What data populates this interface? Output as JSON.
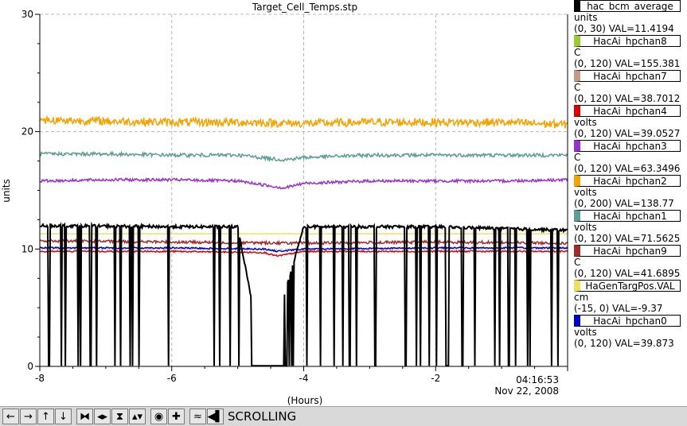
{
  "toolbar": {
    "buttons": [
      "←",
      "→",
      "↑",
      "↓",
      "⧓",
      "◂▸",
      "⧗",
      "▴▾",
      "◉",
      "✚",
      "≈",
      "◀▌"
    ],
    "status": "SCROLLING"
  },
  "chart_data": {
    "type": "line",
    "title": "Target_Cell_Temps.stp",
    "xlabel": "(Hours)",
    "ylabel": "units",
    "xlim": [
      -8.0,
      0.0
    ],
    "ylim": [
      0,
      30
    ],
    "x_ticks": [
      "-8",
      "-6",
      "-4",
      "-2"
    ],
    "y_ticks": [
      "0",
      "10",
      "20",
      "30"
    ],
    "end_time": "04:16:53",
    "end_date": "Nov 22, 2008",
    "grid": true,
    "legend_position": "right",
    "series": [
      {
        "name": "hac_bcm_average",
        "unit": "units",
        "range": "(0, 30) VAL=11.4194",
        "color": "#000000",
        "x": [
          -8.0,
          -6.0,
          -5.0,
          -4.6,
          -4.0,
          -2.0,
          0.0
        ],
        "values": [
          12.0,
          11.9,
          11.9,
          0.0,
          11.9,
          11.9,
          11.6
        ]
      },
      {
        "name": "HacAi_hpchan8",
        "unit": "C",
        "range": "(0, 120) VAL=155.381",
        "color": "#9acd32"
      },
      {
        "name": "HacAi_hpchan7",
        "unit": "C",
        "range": "(0, 120) VAL=38.7012",
        "color": "#c29a8a"
      },
      {
        "name": "HacAi_hpchan4",
        "unit": "volts",
        "range": "(0, 120) VAL=39.0527",
        "color": "#e00000",
        "x": [
          -8.0,
          -6.0,
          -4.6,
          -4.4,
          -4.0,
          -2.0,
          0.0
        ],
        "values": [
          9.8,
          9.8,
          9.7,
          9.4,
          9.8,
          9.8,
          9.8
        ]
      },
      {
        "name": "HacAi_hpchan3",
        "unit": "C",
        "range": "(0, 120) VAL=63.3496",
        "color": "#9932cc",
        "x": [
          -8.0,
          -7.0,
          -6.0,
          -5.0,
          -4.3,
          -4.0,
          -3.0,
          -2.0,
          -1.0,
          0.0
        ],
        "values": [
          15.8,
          15.9,
          15.9,
          15.8,
          15.2,
          15.6,
          15.8,
          15.8,
          15.8,
          15.9
        ]
      },
      {
        "name": "HacAi_hpchan2",
        "unit": "volts",
        "range": "(0, 200) VAL=138.77",
        "color": "#f4a300",
        "x": [
          -8.0,
          -7.0,
          -6.0,
          -5.0,
          -4.0,
          -3.0,
          -2.0,
          -1.0,
          0.0
        ],
        "values": [
          21.0,
          20.9,
          20.8,
          20.8,
          20.7,
          20.8,
          20.8,
          20.8,
          20.6
        ]
      },
      {
        "name": "HacAi_hpchan1",
        "unit": "volts",
        "range": "(0, 120) VAL=71.5625",
        "color": "#5f9e96",
        "x": [
          -8.0,
          -7.0,
          -6.0,
          -5.0,
          -4.3,
          -4.0,
          -3.0,
          -2.0,
          -1.0,
          0.0
        ],
        "values": [
          18.1,
          18.1,
          18.0,
          18.0,
          17.6,
          17.8,
          18.0,
          18.0,
          18.0,
          18.0
        ]
      },
      {
        "name": "HacAi_hpchan9",
        "unit": "C",
        "range": "(0, 120) VAL=41.6895",
        "color": "#a52a2a",
        "x": [
          -8.0,
          -6.0,
          -4.0,
          -2.0,
          0.0
        ],
        "values": [
          10.7,
          10.6,
          10.5,
          10.6,
          10.5
        ]
      },
      {
        "name": "HaGenTargPos.VAL",
        "unit": "cm",
        "range": "(-15, 0) VAL=-9.37",
        "color": "#f0e060",
        "x": [
          -8.0,
          0.0
        ],
        "values": [
          11.3,
          11.3
        ]
      },
      {
        "name": "HacAi_hpchan0",
        "unit": "volts",
        "range": "(0, 120) VAL=39.873",
        "color": "#0000d0",
        "x": [
          -8.0,
          -6.0,
          -4.6,
          -4.4,
          -4.0,
          -2.0,
          0.0
        ],
        "values": [
          10.1,
          10.1,
          10.0,
          9.8,
          10.0,
          10.1,
          10.1
        ]
      }
    ]
  }
}
